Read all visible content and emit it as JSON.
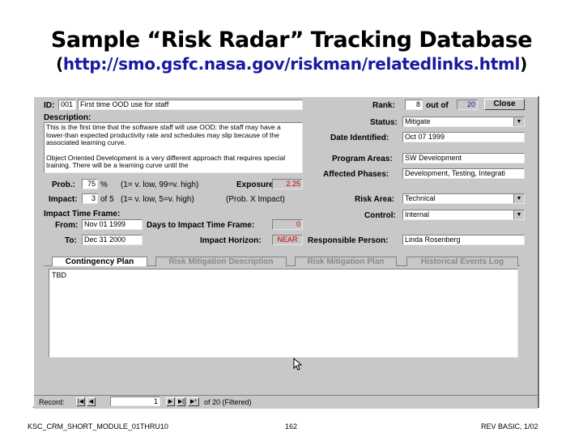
{
  "slide": {
    "title": "Sample “Risk Radar” Tracking Database",
    "subtitle_open": "(",
    "subtitle_link": "http://smo.gsfc.nasa.gov/riskman/relatedlinks.html",
    "subtitle_close": ")",
    "footer_left": "KSC_CRM_SHORT_MODULE_01THRU10",
    "footer_center": "162",
    "footer_right": "REV BASIC, 1/02"
  },
  "form": {
    "id_label": "ID:",
    "id_value": "001",
    "name_value": "First time OOD use for staff",
    "rank_label": "Rank:",
    "rank_value": "8",
    "rank_outof_label": "out of",
    "rank_total": "20",
    "close_label": "Close",
    "description_label": "Description:",
    "description_p1": "This is the first time that the software staff will use OOD; the staff may have a lower-than expected productivity rate and schedules may slip because of the associated learning curve.",
    "description_p2": "Object Oriented Development is a very different approach that requires special training.  There will be a learning curve until the",
    "status_label": "Status:",
    "status_value": "Mitigate",
    "date_identified_label": "Date Identified:",
    "date_identified_value": "Oct 07 1999",
    "program_areas_label": "Program Areas:",
    "program_areas_value": "SW Development",
    "affected_phases_label": "Affected Phases:",
    "affected_phases_value": "Development, Testing, Integrati",
    "prob_label": "Prob.:",
    "prob_value": "75",
    "prob_unit": "%",
    "prob_scale": "(1= v. low, 99=v. high)",
    "exposure_label": "Exposure:",
    "exposure_value": "2.25",
    "impact_label": "Impact:",
    "impact_value": "3",
    "impact_of": "of 5",
    "impact_scale": "(1= v. low, 5=v. high)",
    "impact_formula": "(Prob. X Impact)",
    "risk_area_label": "Risk Area:",
    "risk_area_value": "Technical",
    "impact_time_frame_label": "Impact Time Frame:",
    "control_label": "Control:",
    "control_value": "Internal",
    "from_label": "From:",
    "from_value": "Nov 01 1999",
    "days_to_impact_label": "Days to Impact Time Frame:",
    "days_to_impact_value": "0",
    "to_label": "To:",
    "to_value": "Dec 31 2000",
    "impact_horizon_label": "Impact Horizon:",
    "impact_horizon_value": "NEAR",
    "responsible_person_label": "Responsible Person:",
    "responsible_person_value": "Linda Rosenberg",
    "tabs": [
      {
        "label": "Contingency Plan"
      },
      {
        "label": "Risk Mitigation Description"
      },
      {
        "label": "Risk Mitigation Plan"
      },
      {
        "label": "Historical Events Log"
      }
    ],
    "tab_content": "TBD"
  },
  "record_nav": {
    "label": "Record:",
    "first": "|◀",
    "prev": "◀",
    "current": "1",
    "next": "▶",
    "last": "▶|",
    "new": "▶*",
    "of_text": "of  20 (Filtered)"
  },
  "icons": {
    "dropdown": "▼",
    "cursor": "cursor-icon"
  },
  "colors": {
    "window_bg": "#c8c8c8",
    "red_value": "#cc0000",
    "link": "#1a1aa0"
  }
}
